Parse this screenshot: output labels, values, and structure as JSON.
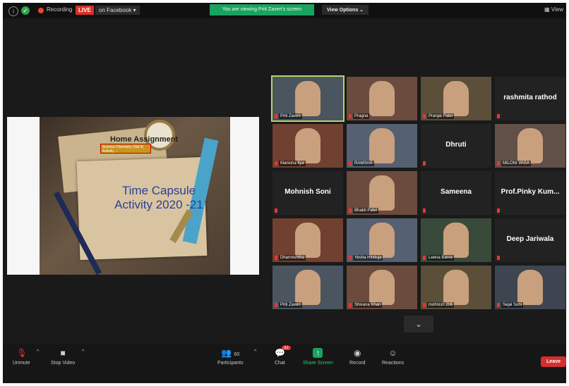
{
  "topbar": {
    "recording_label": "Recording",
    "live_label": "LIVE",
    "stream_target": "on Facebook",
    "viewing_banner": "You are viewing Priti Zaveri's screen",
    "view_options_label": "View Options",
    "view_label": "View"
  },
  "shared_screen": {
    "heading": "Home Assignment",
    "tag_text": "Science Chemistry (Std 9) Activity ...",
    "title_line1": "Time Capsule",
    "title_line2": "Activity 2020 -21"
  },
  "participants": [
    {
      "name": "Priti Zaveri",
      "video": true,
      "highlight": true
    },
    {
      "name": "Pragna",
      "video": true
    },
    {
      "name": "Pranjal Patel",
      "video": true
    },
    {
      "name": "rashmita rathod",
      "video": false
    },
    {
      "name": "Manisha Ilya",
      "video": true
    },
    {
      "name": "RAMSHA",
      "video": true
    },
    {
      "name": "Dhruti",
      "video": false
    },
    {
      "name": "MILONI VASA",
      "video": true
    },
    {
      "name": "Mohnish Soni",
      "video": false
    },
    {
      "name": "Bhakti Patel",
      "video": true
    },
    {
      "name": "Sameena",
      "video": false
    },
    {
      "name": "Prof.Pinky Kum...",
      "video": false
    },
    {
      "name": "Dharmishtha",
      "video": true
    },
    {
      "name": "Yesha Hinduja",
      "video": true
    },
    {
      "name": "Leena Barve",
      "video": true
    },
    {
      "name": "Deep Jariwala",
      "video": false
    },
    {
      "name": "Priti Zaveri",
      "video": true
    },
    {
      "name": "Shivana Khan",
      "video": true
    },
    {
      "name": "mohnish 206",
      "video": true
    },
    {
      "name": "Sejal Soni",
      "video": true
    }
  ],
  "bottombar": {
    "unmute": "Unmute",
    "stop_video": "Stop Video",
    "participants_label": "Participants",
    "participant_count": "60",
    "chat": "Chat",
    "chat_badge": "32",
    "share_screen": "Share Screen",
    "record": "Record",
    "reactions": "Reactions",
    "leave": "Leave"
  },
  "colors": {
    "live_red": "#d93025",
    "share_green": "#1aa260",
    "leave_red": "#d32f2f",
    "active_speaker": "#b7d36a"
  }
}
